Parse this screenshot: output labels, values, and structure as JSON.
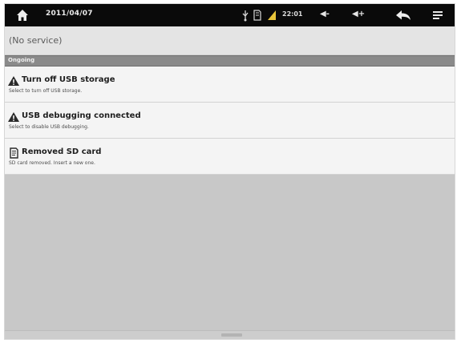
{
  "status_bar": {
    "date": "2011/04/07",
    "time": "22:01",
    "icons": [
      "home-icon",
      "usb-icon",
      "sd-card-icon",
      "signal-icon",
      "volume-down-icon",
      "volume-up-icon",
      "back-icon",
      "menu-icon"
    ],
    "volume_down_label": "◀-",
    "volume_up_label": "◀+"
  },
  "operator": {
    "text": "(No service)"
  },
  "section_header": {
    "label": "Ongoing"
  },
  "notifications": [
    {
      "icon": "warning-icon",
      "title": "Turn off USB storage",
      "subtitle": "Select to turn off USB storage."
    },
    {
      "icon": "warning-icon",
      "title": "USB debugging connected",
      "subtitle": "Select to disable USB debugging."
    },
    {
      "icon": "sd-card-icon",
      "title": "Removed SD card",
      "subtitle": "SD card removed. Insert a new one."
    }
  ],
  "colors": {
    "status_bar_bg": "#0a0a0a",
    "panel_bg": "#c8c8c8",
    "row_bg": "#f4f4f4",
    "header_bg": "#8a8a8a"
  }
}
